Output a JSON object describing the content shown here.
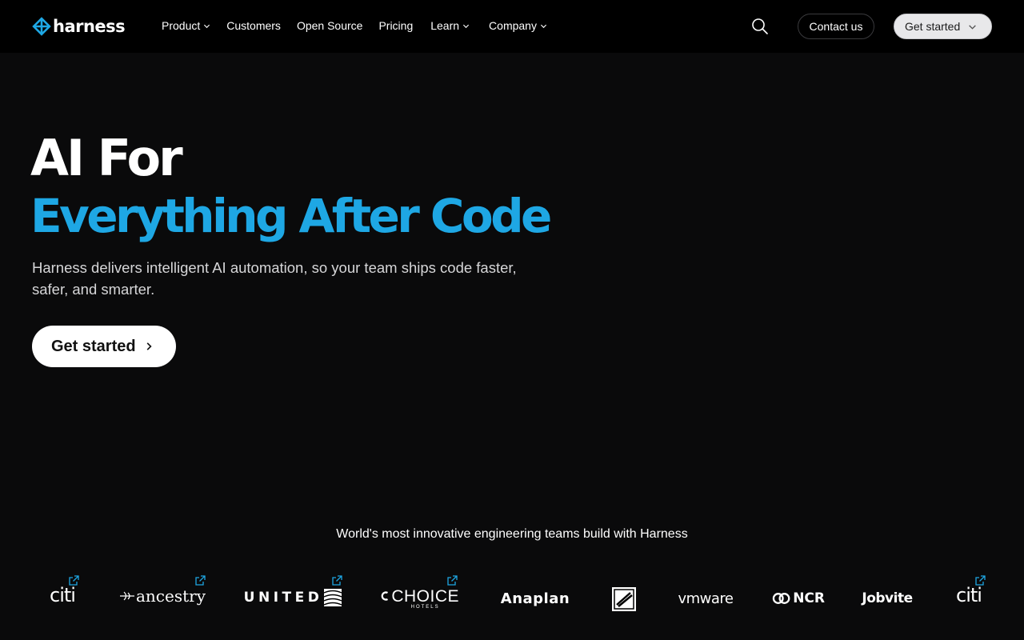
{
  "nav": {
    "brand": "harness",
    "menu": [
      {
        "label": "Product",
        "has_dropdown": true
      },
      {
        "label": "Customers",
        "has_dropdown": false
      },
      {
        "label": "Open Source",
        "has_dropdown": false
      },
      {
        "label": "Pricing",
        "has_dropdown": false
      },
      {
        "label": "Learn",
        "has_dropdown": true
      },
      {
        "label": "Company",
        "has_dropdown": true
      }
    ],
    "search_icon": "search-icon",
    "contact_label": "Contact us",
    "get_started_label": "Get started"
  },
  "hero": {
    "title_line1": "AI For",
    "title_line2": "Everything After Code",
    "subtitle": "Harness delivers intelligent AI automation, so your team ships code faster, safer, and smarter.",
    "cta_label": "Get started",
    "accent_color": "#1ea7e4"
  },
  "customers": {
    "title": "World's most innovative engineering teams build with Harness",
    "logos": [
      {
        "name": "citi",
        "text": "citi",
        "external_link": true
      },
      {
        "name": "ancestry",
        "text": "ancestry",
        "external_link": true
      },
      {
        "name": "united",
        "text": "UNITED",
        "external_link": true
      },
      {
        "name": "choice-hotels",
        "text": "CHOICE",
        "subtext": "HOTELS",
        "external_link": true
      },
      {
        "name": "anaplan",
        "text": "Anaplan",
        "external_link": false
      },
      {
        "name": "home-depot",
        "text": "",
        "external_link": false
      },
      {
        "name": "vmware",
        "text": "vmware",
        "external_link": false
      },
      {
        "name": "ncr",
        "text": "NCR",
        "external_link": false
      },
      {
        "name": "jobvite",
        "text": "Jobvite",
        "external_link": false
      },
      {
        "name": "citi-2",
        "text": "citi",
        "external_link": true
      }
    ]
  }
}
